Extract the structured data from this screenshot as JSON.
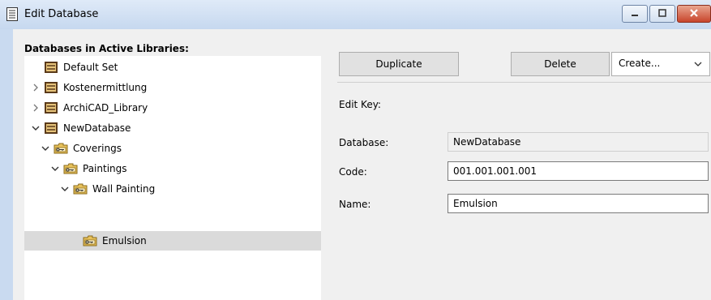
{
  "window": {
    "title": "Edit Database",
    "icons": [
      "document-icon",
      "minimize-icon",
      "maximize-icon",
      "close-icon"
    ]
  },
  "tree": {
    "heading": "Databases in Active Libraries:",
    "items": [
      {
        "label": "Default Set",
        "icon": "database-icon"
      },
      {
        "label": "Kostenermittlung",
        "icon": "database-icon",
        "expander": "collapsed"
      },
      {
        "label": "ArchiCAD_Library",
        "icon": "database-icon",
        "expander": "collapsed"
      },
      {
        "label": "NewDatabase",
        "icon": "database-icon",
        "expander": "expanded"
      },
      {
        "label": "Coverings",
        "icon": "key-folder-icon",
        "expander": "expanded"
      },
      {
        "label": "Paintings",
        "icon": "key-folder-icon",
        "expander": "expanded"
      },
      {
        "label": "Wall Painting",
        "icon": "key-folder-icon",
        "expander": "expanded"
      },
      {
        "label": "Emulsion",
        "icon": "key-folder-icon",
        "selected": true
      }
    ]
  },
  "toolbar": {
    "duplicate_label": "Duplicate",
    "delete_label": "Delete",
    "create_value": "Create..."
  },
  "form": {
    "section_label": "Edit Key:",
    "database_label": "Database:",
    "database_value": "NewDatabase",
    "code_label": "Code:",
    "code_value": "001.001.001.001",
    "name_label": "Name:",
    "name_value": "Emulsion"
  },
  "colors": {
    "titlebar": "#c9daf0",
    "selection": "#dadada",
    "close_button": "#c8452c"
  }
}
